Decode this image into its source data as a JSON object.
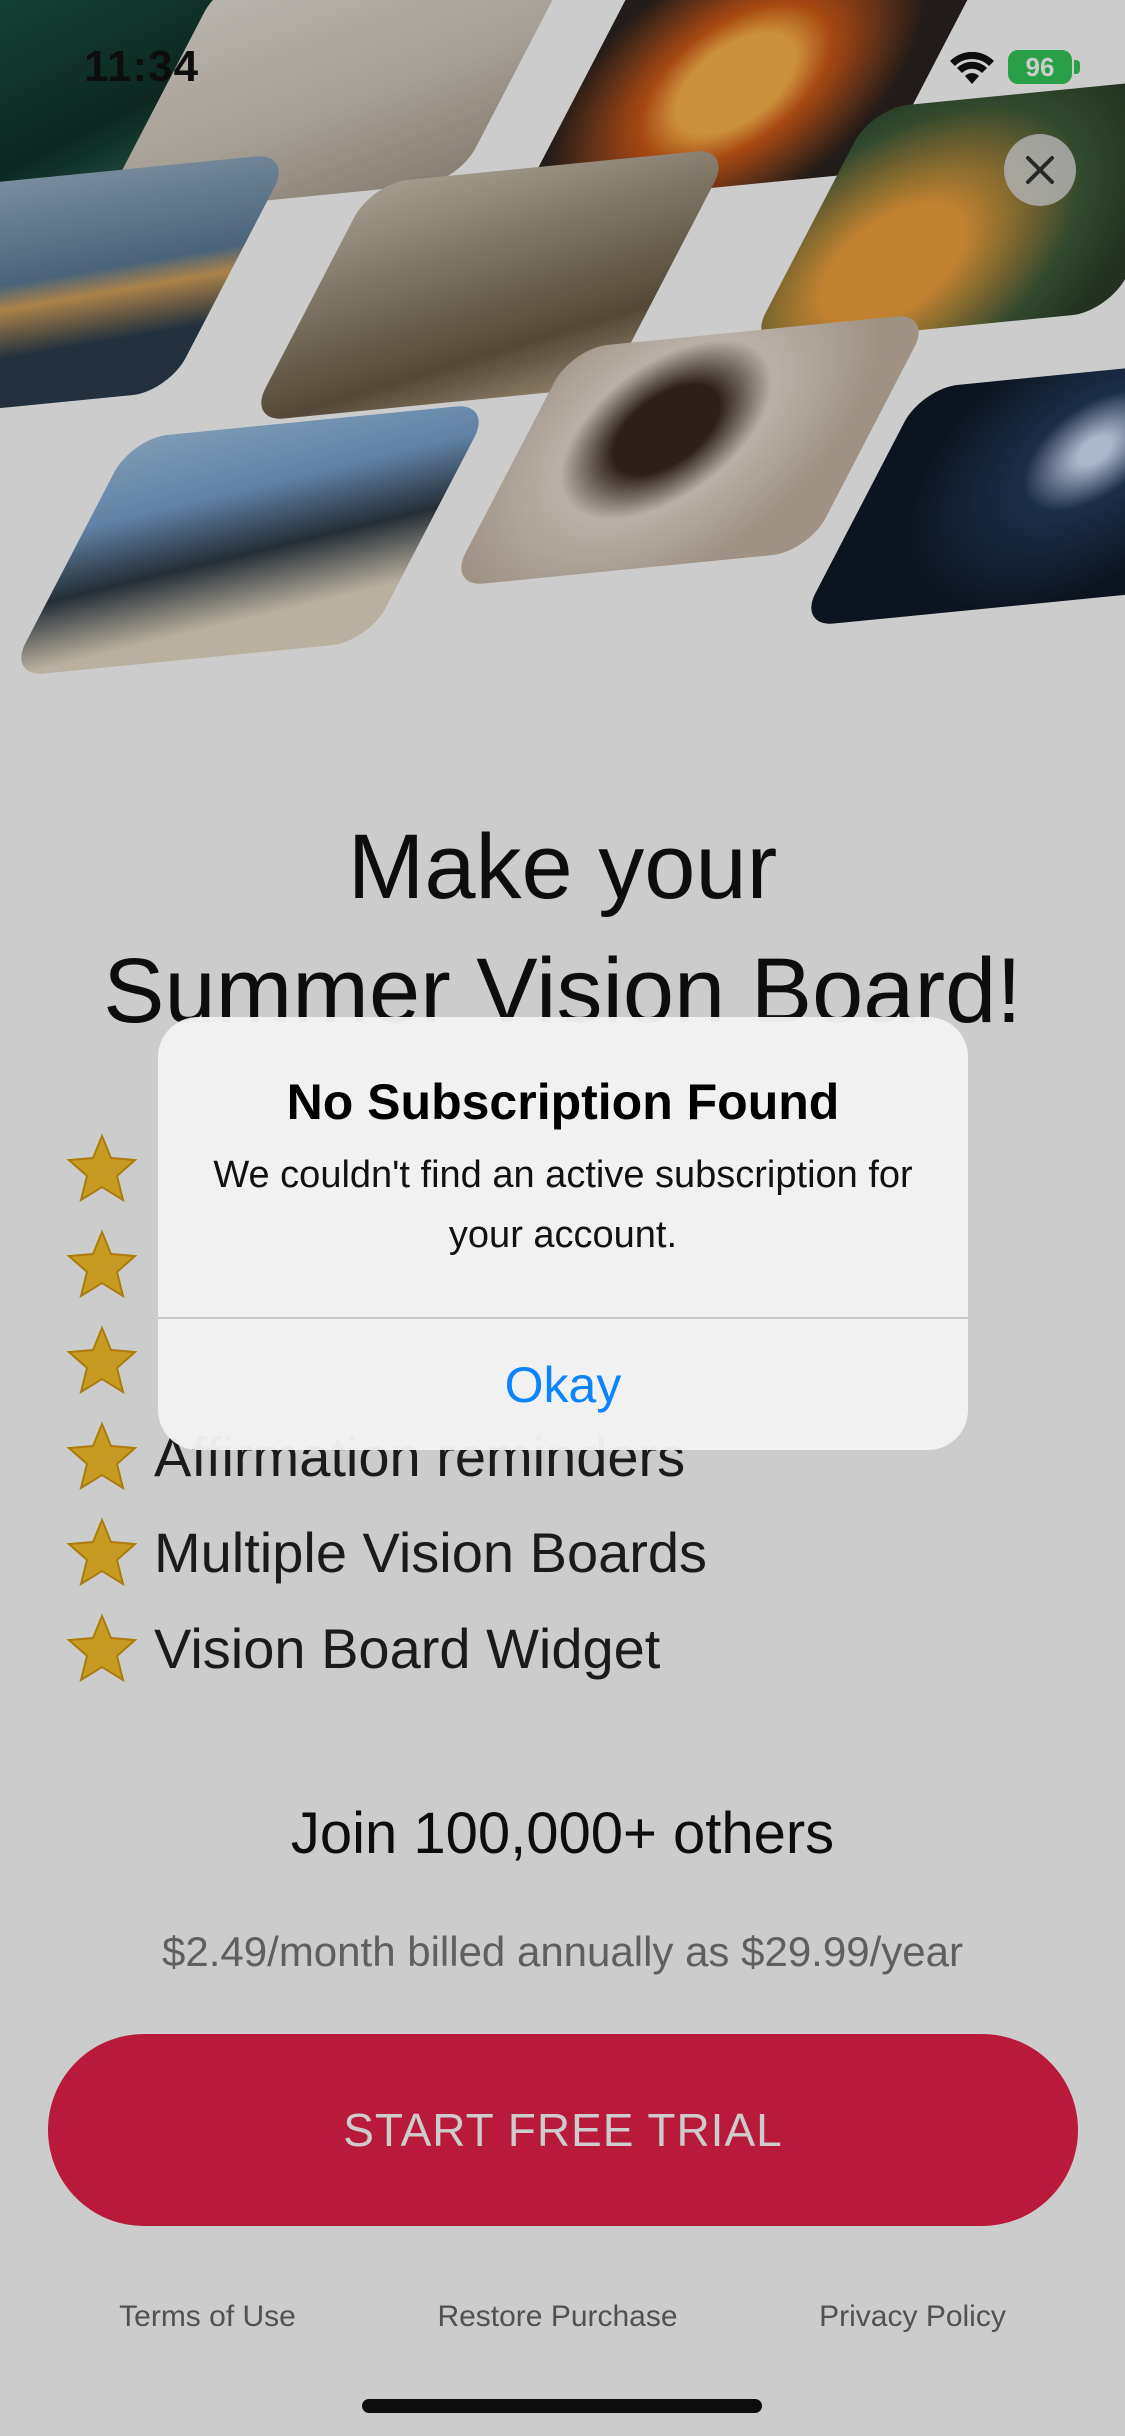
{
  "status_bar": {
    "time": "11:34",
    "battery": "96"
  },
  "collage": {
    "tiles": [
      "car",
      "yoga",
      "bonfire",
      "flowers",
      "beach",
      "art-studio",
      "camera",
      "night-sky",
      "house"
    ]
  },
  "headline": {
    "line1": "Make your",
    "line2": "Summer Vision Board!"
  },
  "features": {
    "items": [
      {
        "label": "",
        "icon": "star-icon"
      },
      {
        "label": "",
        "icon": "star-icon"
      },
      {
        "label": "",
        "icon": "star-icon"
      },
      {
        "label": "Affirmation reminders",
        "icon": "star-icon"
      },
      {
        "label": "Multiple Vision Boards",
        "icon": "star-icon"
      },
      {
        "label": "Vision Board Widget",
        "icon": "star-icon"
      }
    ]
  },
  "social_proof": "Join 100,000+ others",
  "pricing": "$2.49/month billed annually as $29.99/year",
  "cta": {
    "label": "START FREE TRIAL"
  },
  "footer": {
    "terms": "Terms of Use",
    "restore": "Restore Purchase",
    "privacy": "Privacy Policy"
  },
  "alert": {
    "title": "No Subscription Found",
    "message": "We couldn't find an active subscription for your account.",
    "button": "Okay"
  },
  "colors": {
    "accent": "#e8204a",
    "link_blue": "#0a84ff",
    "battery_green": "#34c759"
  }
}
